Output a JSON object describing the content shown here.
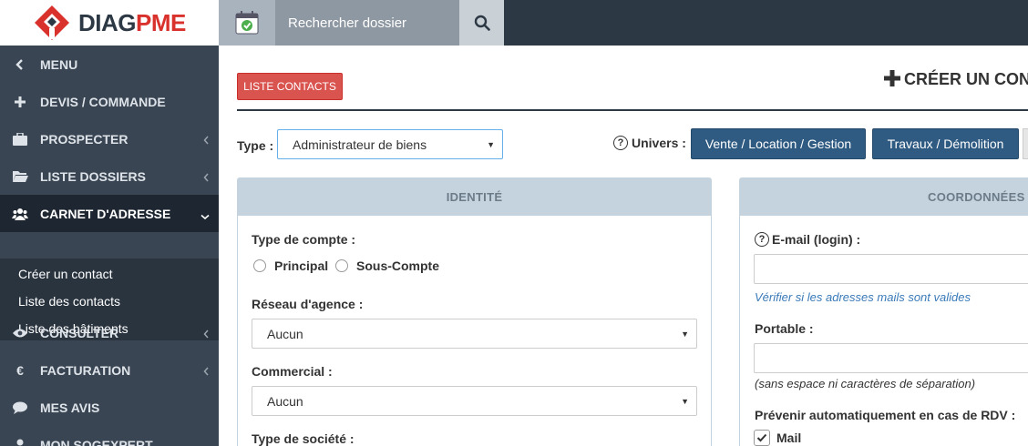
{
  "brand": {
    "name_a": "DIAG",
    "name_b": "PME",
    "color_dark": "#2d3845",
    "color_red": "#d9312b"
  },
  "topbar": {
    "search_placeholder": "Rechercher dossier",
    "calendar_icon": "calendar-check-icon",
    "search_icon": "search-icon"
  },
  "sidebar": {
    "items": [
      {
        "label": "MENU",
        "icon": "chevron-left-icon"
      },
      {
        "label": "DEVIS / COMMANDE",
        "icon": "plus-icon"
      },
      {
        "label": "PROSPECTER",
        "icon": "briefcase-icon"
      },
      {
        "label": "LISTE DOSSIERS",
        "icon": "folder-open-icon"
      },
      {
        "label": "CARNET D'ADRESSE",
        "icon": "users-icon"
      },
      {
        "label": "CONSULTER",
        "icon": "eye-icon"
      },
      {
        "label": "FACTURATION",
        "icon": "euro-icon"
      },
      {
        "label": "MES AVIS",
        "icon": "comments-icon"
      },
      {
        "label": "MON SOGEXPERT",
        "icon": "user-icon"
      }
    ],
    "submenu": [
      "Créer un contact",
      "Liste des contacts",
      "Liste des bâtiments"
    ]
  },
  "main": {
    "list_button": "LISTE CONTACTS",
    "create_title": "CRÉER UN CON",
    "type_label": "Type :",
    "type_value": "Administrateur de biens",
    "univers_label": "Univers :",
    "univers_buttons": [
      "Vente / Location / Gestion",
      "Travaux / Démolition"
    ],
    "identite": {
      "header": "IDENTITÉ",
      "type_compte_label": "Type de compte :",
      "radio_principal": "Principal",
      "radio_souscompte": "Sous-Compte",
      "reseau_label": "Réseau d'agence :",
      "reseau_value": "Aucun",
      "commercial_label": "Commercial :",
      "commercial_value": "Aucun",
      "type_societe_label": "Type de société :"
    },
    "coordonnees": {
      "header": "COORDONNÉES",
      "email_label": "E-mail (login) :",
      "email_help": "Vérifier si les adresses mails sont valides",
      "portable_label": "Portable :",
      "portable_help": "(sans espace ni caractères de séparation)",
      "prevenir_label": "Prévenir automatiquement en cas de RDV :",
      "mail_checkbox": "Mail"
    }
  }
}
